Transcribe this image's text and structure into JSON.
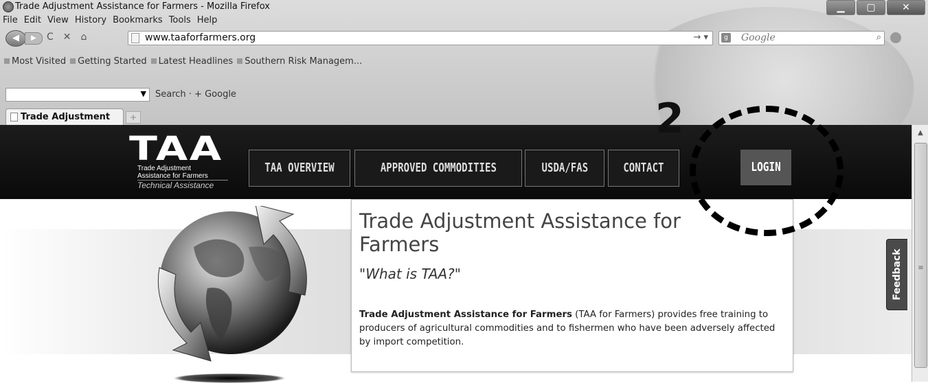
{
  "window": {
    "title": "Trade Adjustment Assistance for Farmers - Mozilla Firefox",
    "buttons": {
      "minimize": "▁",
      "maximize": "▢",
      "close": "✕"
    }
  },
  "menu": [
    "File",
    "Edit",
    "View",
    "History",
    "Bookmarks",
    "Tools",
    "Help"
  ],
  "navbar": {
    "url": "www.taaforfarmers.org",
    "search_placeholder": "Google"
  },
  "bookmarks": [
    "Most Visited",
    "Getting Started",
    "Latest Headlines",
    "Southern Risk Managem..."
  ],
  "toolbar2": {
    "search_label": "Search · + Google"
  },
  "tab": {
    "label": "Trade Adjustment Assis...",
    "new_tab": "+"
  },
  "site": {
    "logo": {
      "big": "TAA",
      "line1": "Trade Adjustment",
      "line2": "Assistance for Farmers",
      "line3": "Technical Assistance"
    },
    "nav": [
      "TAA OVERVIEW",
      "APPROVED COMMODITIES",
      "USDA/FAS",
      "CONTACT"
    ],
    "login": "LOGIN",
    "heading": "Trade Adjustment Assistance for Farmers",
    "subheading": "\"What is TAA?\"",
    "body_bold": "Trade Adjustment Assistance for Farmers",
    "body_text": " (TAA for Farmers) provides free training to producers of agricultural commodities and to fishermen who have been adversely affected by import competition.",
    "feedback": "Feedback"
  },
  "annotation": {
    "number": "2"
  },
  "colors": {
    "header_bg": "#111111",
    "login_bg": "#555555",
    "feedback_bg": "#4a4a4a"
  },
  "icons": [
    "firefox-icon",
    "back-icon",
    "forward-icon",
    "reload-icon",
    "stop-icon",
    "home-icon",
    "page-icon",
    "go-icon",
    "google-icon",
    "search-icon",
    "globe-icon"
  ]
}
